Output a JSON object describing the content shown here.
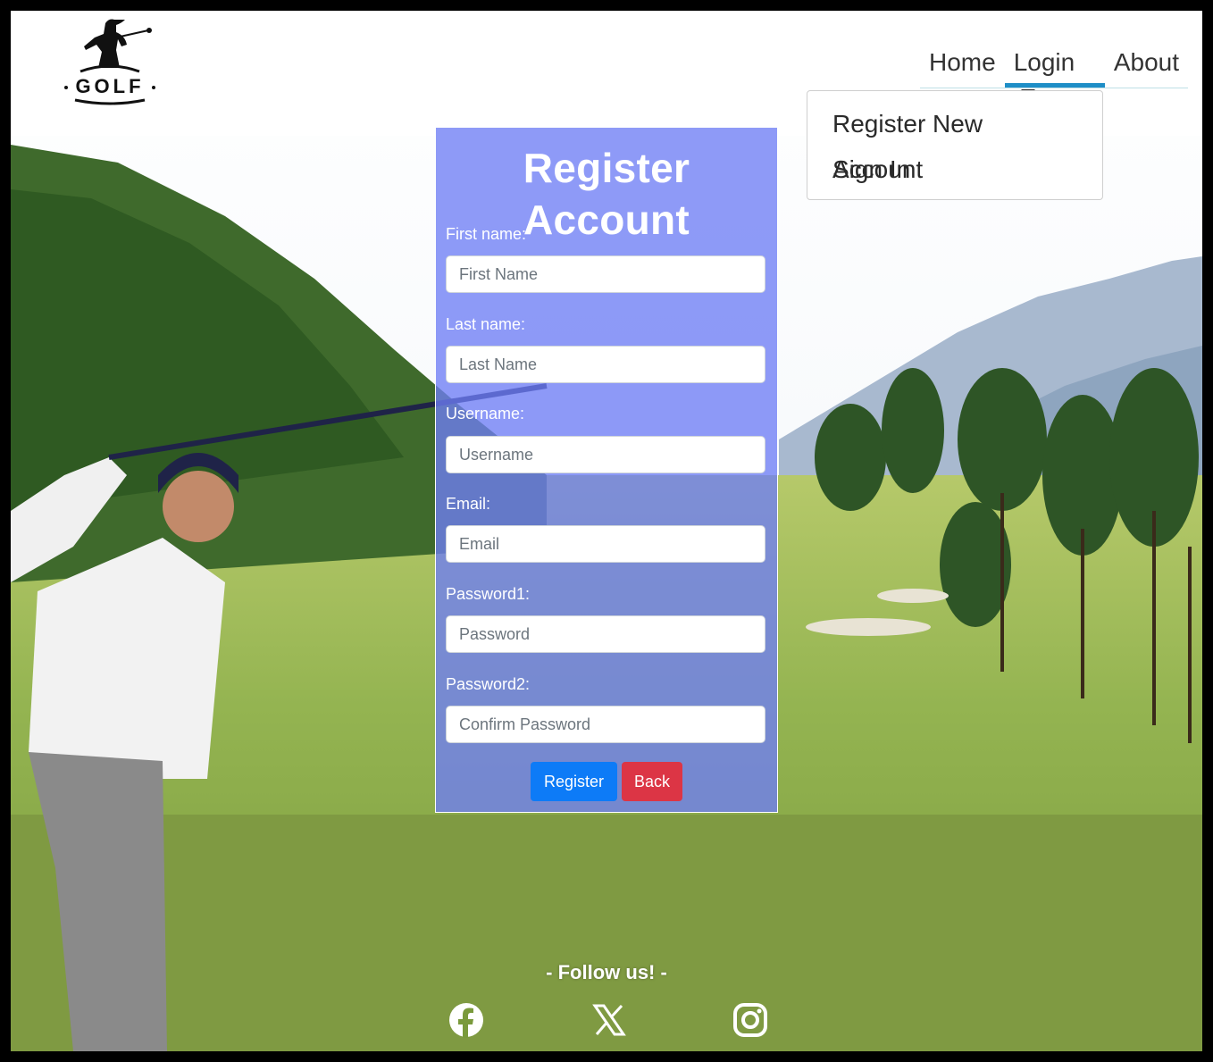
{
  "logo": {
    "text": "GOLF",
    "icon": "golfer-logo-icon"
  },
  "nav": {
    "items": [
      {
        "label": "Home"
      },
      {
        "label": "Login"
      },
      {
        "label": "About"
      }
    ],
    "active": "Login"
  },
  "dropdown": {
    "items": [
      {
        "label": "Register New Account"
      },
      {
        "label": "Sign In"
      }
    ]
  },
  "form": {
    "title": "Register Account",
    "fields": [
      {
        "label": "First name:",
        "placeholder": "First Name",
        "value": ""
      },
      {
        "label": "Last name:",
        "placeholder": "Last Name",
        "value": ""
      },
      {
        "label": "Username:",
        "placeholder": "Username",
        "value": ""
      },
      {
        "label": "Email:",
        "placeholder": "Email",
        "value": ""
      },
      {
        "label": "Password1:",
        "placeholder": "Password",
        "value": ""
      },
      {
        "label": "Password2:",
        "placeholder": "Confirm Password",
        "value": ""
      }
    ],
    "register_label": "Register",
    "back_label": "Back"
  },
  "footer": {
    "follow_text": "- Follow us! -",
    "social": [
      "facebook-icon",
      "x-icon",
      "instagram-icon"
    ]
  },
  "colors": {
    "form_bg": "#6e7df5",
    "primary": "#0d7bf7",
    "danger": "#dc3545",
    "nav_active": "#1e8ec7"
  }
}
